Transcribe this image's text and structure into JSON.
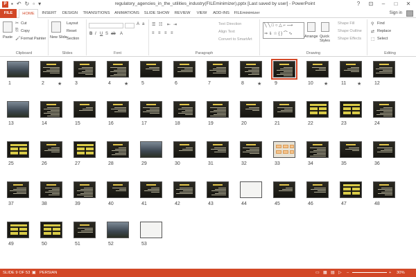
{
  "window": {
    "app_icon": "P",
    "title": "regulatory_agencies_in_the_utilities_industry(FILEminimizer).pptx [Last saved by user] - PowerPoint",
    "help_icon": "?"
  },
  "tabs": [
    "FILE",
    "HOME",
    "INSERT",
    "DESIGN",
    "TRANSITIONS",
    "ANIMATIONS",
    "SLIDE SHOW",
    "REVIEW",
    "VIEW",
    "ADD-INS",
    "FILEminimizer"
  ],
  "sign_in": "Sign in",
  "ribbon": {
    "clipboard": {
      "paste": "Paste",
      "cut": "Cut",
      "copy": "Copy",
      "format_painter": "Format Painter",
      "label": "Clipboard"
    },
    "slides": {
      "new_slide": "New Slide",
      "layout": "Layout",
      "reset": "Reset",
      "section": "Section",
      "label": "Slides"
    },
    "font": {
      "label": "Font"
    },
    "paragraph": {
      "text_direction": "Text Direction",
      "align_text": "Align Text",
      "convert_smartart": "Convert to SmartArt",
      "label": "Paragraph"
    },
    "drawing": {
      "arrange": "Arrange",
      "quick_styles": "Quick Styles",
      "shape_fill": "Shape Fill",
      "shape_outline": "Shape Outline",
      "shape_effects": "Shape Effects",
      "label": "Drawing"
    },
    "editing": {
      "find": "Find",
      "replace": "Replace",
      "select": "Select",
      "label": "Editing"
    }
  },
  "slides": {
    "selected": 9,
    "numbers": [
      "1",
      "2",
      "3",
      "4",
      "5",
      "6",
      "7",
      "8",
      "9",
      "10",
      "11",
      "12",
      "13",
      "14",
      "15",
      "16",
      "17",
      "18",
      "19",
      "20",
      "21",
      "22",
      "23",
      "24",
      "25",
      "26",
      "27",
      "28",
      "29",
      "30",
      "31",
      "32",
      "33",
      "34",
      "35",
      "36",
      "37",
      "38",
      "39",
      "40",
      "41",
      "42",
      "43",
      "44",
      "45",
      "46",
      "47",
      "48",
      "49",
      "50",
      "51",
      "52",
      "53"
    ],
    "animated": [
      2,
      4,
      8,
      10,
      11
    ],
    "star_glyph": "★"
  },
  "status": {
    "slide_info": "SLIDE 9 OF 53",
    "language": "PERSIAN",
    "zoom": "30%"
  }
}
